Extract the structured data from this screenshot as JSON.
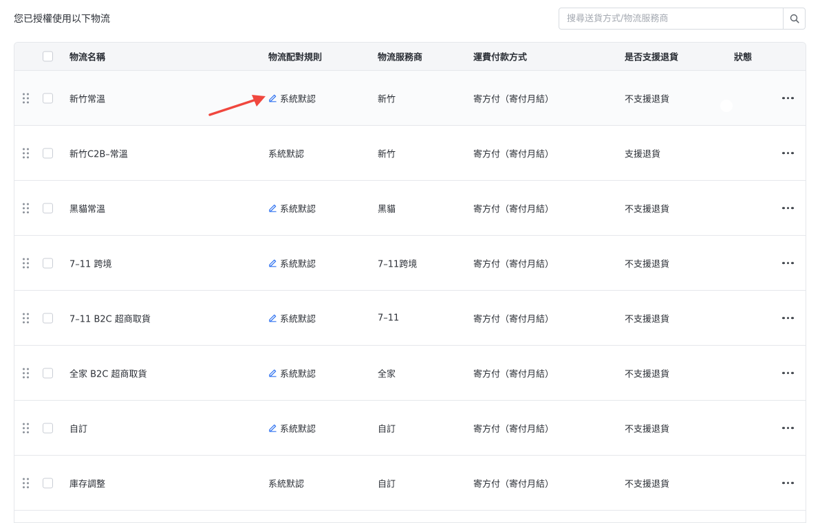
{
  "header": {
    "title": "您已授權使用以下物流",
    "search_placeholder": "搜尋送貨方式/物流服務商"
  },
  "table": {
    "columns": {
      "name": "物流名稱",
      "rule": "物流配對規則",
      "provider": "物流服務商",
      "payment": "運費付款方式",
      "returns": "是否支援退貨",
      "status": "狀態"
    },
    "rows": [
      {
        "name": "新竹常溫",
        "rule": "系統默認",
        "rule_editable": true,
        "provider": "新竹",
        "payment": "寄方付（寄付月結）",
        "returns": "不支援退貨",
        "enabled": true
      },
      {
        "name": "新竹C2B–常溫",
        "rule": "系統默認",
        "rule_editable": false,
        "provider": "新竹",
        "payment": "寄方付（寄付月結）",
        "returns": "支援退貨",
        "enabled": true
      },
      {
        "name": "黑貓常溫",
        "rule": "系統默認",
        "rule_editable": true,
        "provider": "黑貓",
        "payment": "寄方付（寄付月結）",
        "returns": "不支援退貨",
        "enabled": true
      },
      {
        "name": "7–11 跨境",
        "rule": "系統默認",
        "rule_editable": true,
        "provider": "7–11跨境",
        "payment": "寄方付（寄付月結）",
        "returns": "不支援退貨",
        "enabled": false
      },
      {
        "name": "7–11 B2C 超商取貨",
        "rule": "系統默認",
        "rule_editable": true,
        "provider": "7–11",
        "payment": "寄方付（寄付月結）",
        "returns": "不支援退貨",
        "enabled": false
      },
      {
        "name": "全家 B2C 超商取貨",
        "rule": "系統默認",
        "rule_editable": true,
        "provider": "全家",
        "payment": "寄方付（寄付月結）",
        "returns": "不支援退貨",
        "enabled": true
      },
      {
        "name": "自訂",
        "rule": "系統默認",
        "rule_editable": true,
        "provider": "自訂",
        "payment": "寄方付（寄付月結）",
        "returns": "不支援退貨",
        "enabled": true
      },
      {
        "name": "庫存調整",
        "rule": "系統默認",
        "rule_editable": false,
        "provider": "自訂",
        "payment": "寄方付（寄付月結）",
        "returns": "不支援退貨",
        "enabled": true
      }
    ]
  },
  "colors": {
    "accent": "#2a6ff0",
    "toggle_off": "#b7bbc2",
    "annotation_arrow": "#f0473e"
  },
  "icons": [
    "search-icon",
    "drag-handle-icon",
    "edit-icon",
    "more-icon",
    "annotation-arrow"
  ]
}
